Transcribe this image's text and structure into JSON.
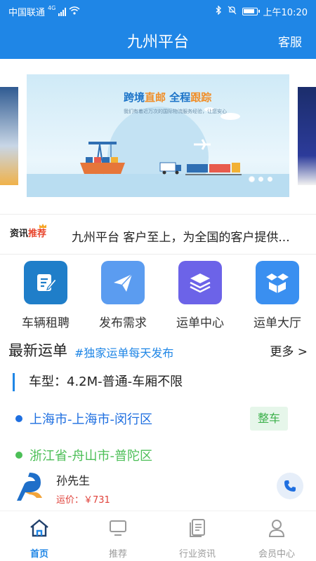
{
  "status_bar": {
    "carrier": "中国联通",
    "network": "4G",
    "time": "上午10:20"
  },
  "header": {
    "title": "九州平台",
    "service_label": "客服"
  },
  "banner": {
    "headline_part1": "跨境",
    "headline_highlight1": "直邮",
    "headline_part2": " 全程",
    "headline_highlight2": "跟踪",
    "subtext": "我们有着近万次的国际物流服务经验，让您安心",
    "slide_count": 3,
    "active_slide": 1
  },
  "news": {
    "tag_part1": "资讯",
    "tag_part2": "推荐",
    "text": "九州平台 客户至上，为全国的客户提供..."
  },
  "quick_menu": [
    {
      "label": "车辆租聘",
      "icon": "edit-icon",
      "color": "#1f7ec9"
    },
    {
      "label": "发布需求",
      "icon": "send-icon",
      "color": "#5b9cf0"
    },
    {
      "label": "运单中心",
      "icon": "layers-icon",
      "color": "#6c63e8"
    },
    {
      "label": "运单大厅",
      "icon": "box-icon",
      "color": "#3a8ff0"
    }
  ],
  "latest_orders": {
    "title": "最新运单",
    "tag": "#独家运单每天发布",
    "more_label": "更多 >",
    "order": {
      "car_type": "车型：4.2M-普通-车厢不限",
      "origin": "上海市-上海市-闵行区",
      "destination": "浙江省-舟山市-普陀区",
      "load_type": "整车",
      "contact_name": "孙先生",
      "freight": "运价：￥731"
    }
  },
  "tab_bar": [
    {
      "label": "首页",
      "icon": "home-icon",
      "active": true
    },
    {
      "label": "推荐",
      "icon": "monitor-icon",
      "active": false
    },
    {
      "label": "行业资讯",
      "icon": "document-icon",
      "active": false
    },
    {
      "label": "会员中心",
      "icon": "user-icon",
      "active": false
    }
  ],
  "colors": {
    "primary": "#1f86e6",
    "origin_dot": "#1f6fe0",
    "destination_dot": "#4cbf57",
    "badge_text": "#3bb04a",
    "freight_text": "#e0413a"
  }
}
